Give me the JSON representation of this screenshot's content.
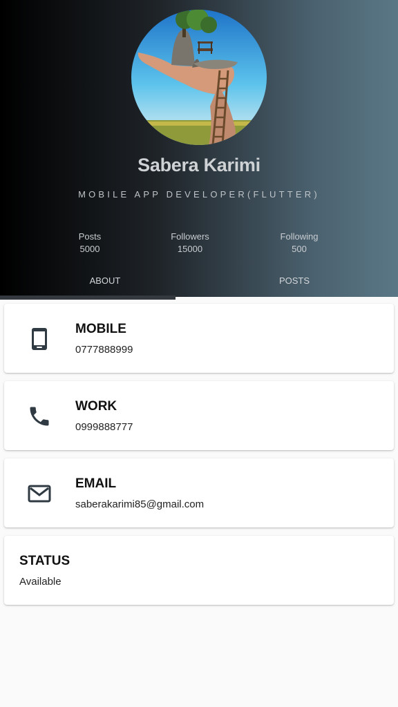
{
  "profile": {
    "name": "Sabera Karimi",
    "tagline": "MOBILE APP DEVELOPER(FLUTTER)"
  },
  "stats": [
    {
      "label": "Posts",
      "value": "5000"
    },
    {
      "label": "Followers",
      "value": "15000"
    },
    {
      "label": "Following",
      "value": "500"
    }
  ],
  "tabs": [
    {
      "label": "ABOUT",
      "selected": true
    },
    {
      "label": "POSTS",
      "selected": false
    }
  ],
  "contacts": [
    {
      "title": "MOBILE",
      "value": "0777888999",
      "icon": "smartphone-icon"
    },
    {
      "title": "WORK",
      "value": "0999888777",
      "icon": "phone-icon"
    },
    {
      "title": "EMAIL",
      "value": "saberakarimi85@gmail.com",
      "icon": "mail-icon"
    }
  ],
  "status": {
    "title": "STATUS",
    "value": "Available"
  },
  "colors": {
    "header_gradient_start": "#000000",
    "header_gradient_end": "#5a7785",
    "icon_color": "#2f3a42",
    "tab_indicator": "#33393f"
  }
}
